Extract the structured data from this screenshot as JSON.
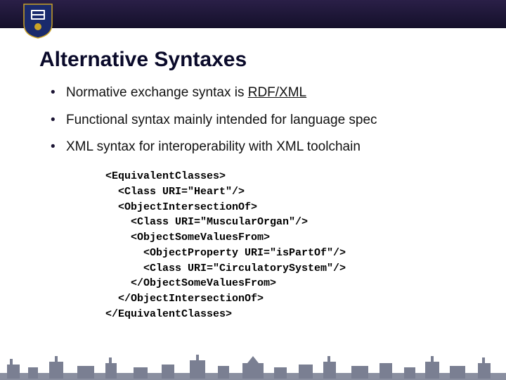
{
  "header": {},
  "title": "Alternative Syntaxes",
  "bullets": [
    {
      "prefix": "Normative exchange syntax is ",
      "linked": "RDF/XML",
      "suffix": ""
    },
    {
      "prefix": "Functional syntax mainly intended for language spec",
      "linked": "",
      "suffix": ""
    },
    {
      "prefix": "XML syntax for interoperability with XML toolchain",
      "linked": "",
      "suffix": ""
    }
  ],
  "code": "<EquivalentClasses>\n  <Class URI=\"Heart\"/>\n  <ObjectIntersectionOf>\n    <Class URI=\"MuscularOrgan\"/>\n    <ObjectSomeValuesFrom>\n      <ObjectProperty URI=\"isPartOf\"/>\n      <Class URI=\"CirculatorySystem\"/>\n    </ObjectSomeValuesFrom>\n  </ObjectIntersectionOf>\n</EquivalentClasses>"
}
